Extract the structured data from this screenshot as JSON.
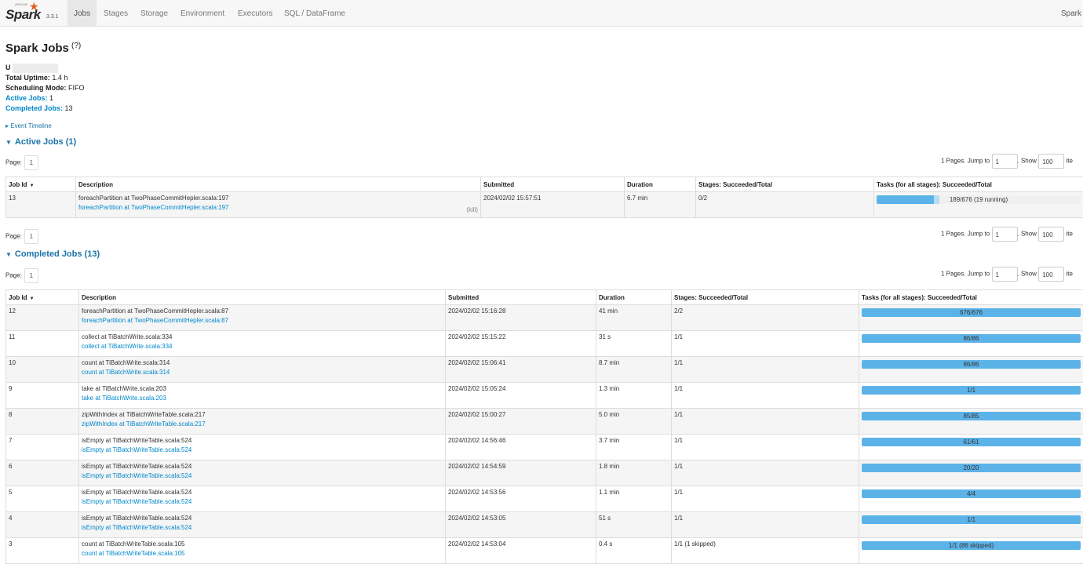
{
  "nav": {
    "logo_apache": "APACHE",
    "logo_text": "Spark",
    "version": "3.3.1",
    "tabs": [
      "Jobs",
      "Stages",
      "Storage",
      "Environment",
      "Executors",
      "SQL / DataFrame"
    ],
    "active_tab": "Jobs",
    "right_label": "Spark"
  },
  "page": {
    "title": "Spark Jobs",
    "help": "(?)",
    "user_prefix": "U",
    "uptime_label": "Total Uptime:",
    "uptime_value": "1.4 h",
    "mode_label": "Scheduling Mode:",
    "mode_value": "FIFO",
    "active_jobs_label": "Active Jobs:",
    "active_jobs_value": "1",
    "completed_jobs_label": "Completed Jobs:",
    "completed_jobs_value": "13",
    "event_timeline": "Event Timeline"
  },
  "pager": {
    "page_label": "Page:",
    "page_num": "1",
    "pages_text": "1 Pages. Jump to",
    "jump_value": "1",
    "show_text": ". Show",
    "show_value": "100",
    "items_text": "ite"
  },
  "active": {
    "heading": "Active Jobs (1)",
    "columns": [
      "Job Id",
      "Description",
      "Submitted",
      "Duration",
      "Stages: Succeeded/Total",
      "Tasks (for all stages): Succeeded/Total"
    ],
    "kill": "(kill)",
    "rows": [
      {
        "id": "13",
        "desc": "foreachPartition at TwoPhaseCommitHepler.scala:197",
        "desc_link": "foreachPartition at TwoPhaseCommitHepler.scala:197",
        "submitted": "2024/02/02 15:57:51",
        "duration": "6.7 min",
        "stages": "0/2",
        "tasks": "189/676 (19 running)",
        "done_frac": 0.28,
        "running_frac": 0.028
      }
    ]
  },
  "completed": {
    "heading": "Completed Jobs (13)",
    "columns": [
      "Job Id",
      "Description",
      "Submitted",
      "Duration",
      "Stages: Succeeded/Total",
      "Tasks (for all stages): Succeeded/Total"
    ],
    "rows": [
      {
        "id": "12",
        "desc": "foreachPartition at TwoPhaseCommitHepler.scala:87",
        "desc_link": "foreachPartition at TwoPhaseCommitHepler.scala:87",
        "submitted": "2024/02/02 15:16:28",
        "duration": "41 min",
        "stages": "2/2",
        "tasks": "676/676"
      },
      {
        "id": "11",
        "desc": "collect at TiBatchWrite.scala:334",
        "desc_link": "collect at TiBatchWrite.scala:334",
        "submitted": "2024/02/02 15:15:22",
        "duration": "31 s",
        "stages": "1/1",
        "tasks": "86/86"
      },
      {
        "id": "10",
        "desc": "count at TiBatchWrite.scala:314",
        "desc_link": "count at TiBatchWrite.scala:314",
        "submitted": "2024/02/02 15:06:41",
        "duration": "8.7 min",
        "stages": "1/1",
        "tasks": "86/86"
      },
      {
        "id": "9",
        "desc": "take at TiBatchWrite.scala:203",
        "desc_link": "take at TiBatchWrite.scala:203",
        "submitted": "2024/02/02 15:05:24",
        "duration": "1.3 min",
        "stages": "1/1",
        "tasks": "1/1"
      },
      {
        "id": "8",
        "desc": "zipWithIndex at TiBatchWriteTable.scala:217",
        "desc_link": "zipWithIndex at TiBatchWriteTable.scala:217",
        "submitted": "2024/02/02 15:00:27",
        "duration": "5.0 min",
        "stages": "1/1",
        "tasks": "85/85"
      },
      {
        "id": "7",
        "desc": "isEmpty at TiBatchWriteTable.scala:524",
        "desc_link": "isEmpty at TiBatchWriteTable.scala:524",
        "submitted": "2024/02/02 14:56:46",
        "duration": "3.7 min",
        "stages": "1/1",
        "tasks": "61/61"
      },
      {
        "id": "6",
        "desc": "isEmpty at TiBatchWriteTable.scala:524",
        "desc_link": "isEmpty at TiBatchWriteTable.scala:524",
        "submitted": "2024/02/02 14:54:59",
        "duration": "1.8 min",
        "stages": "1/1",
        "tasks": "20/20"
      },
      {
        "id": "5",
        "desc": "isEmpty at TiBatchWriteTable.scala:524",
        "desc_link": "isEmpty at TiBatchWriteTable.scala:524",
        "submitted": "2024/02/02 14:53:56",
        "duration": "1.1 min",
        "stages": "1/1",
        "tasks": "4/4"
      },
      {
        "id": "4",
        "desc": "isEmpty at TiBatchWriteTable.scala:524",
        "desc_link": "isEmpty at TiBatchWriteTable.scala:524",
        "submitted": "2024/02/02 14:53:05",
        "duration": "51 s",
        "stages": "1/1",
        "tasks": "1/1"
      },
      {
        "id": "3",
        "desc": "count at TiBatchWriteTable.scala:105",
        "desc_link": "count at TiBatchWriteTable.scala:105",
        "submitted": "2024/02/02 14:53:04",
        "duration": "0.4 s",
        "stages": "1/1 (1 skipped)",
        "tasks": "1/1 (86 skipped)"
      }
    ]
  },
  "colors": {
    "accent": "#0088cc",
    "progress": "#5cb3e8",
    "running": "#b8dcf2",
    "logo_orange": "#e25a1c"
  }
}
